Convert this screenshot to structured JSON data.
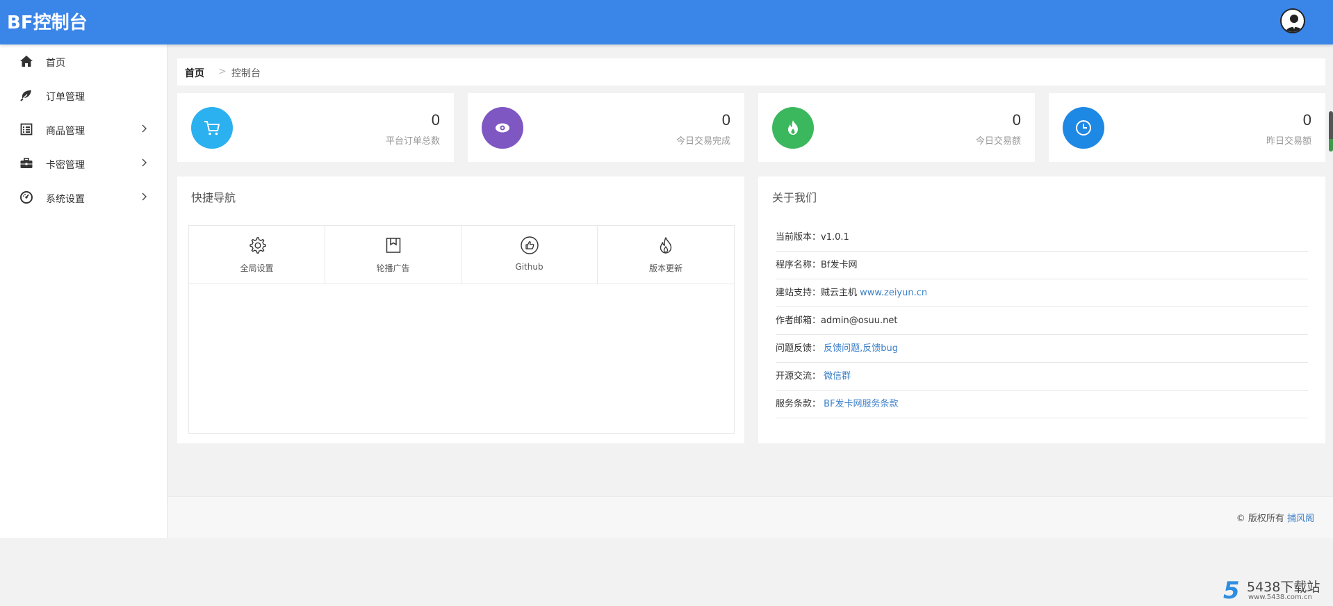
{
  "header": {
    "brand": "BF控制台",
    "avatar_icon": "user-avatar-icon"
  },
  "sidebar": {
    "items": [
      {
        "label": "首页",
        "icon": "home-icon",
        "has_children": false
      },
      {
        "label": "订单管理",
        "icon": "leaf-icon",
        "has_children": false
      },
      {
        "label": "商品管理",
        "icon": "list-icon",
        "has_children": true
      },
      {
        "label": "卡密管理",
        "icon": "briefcase-icon",
        "has_children": true
      },
      {
        "label": "系统设置",
        "icon": "dashboard-icon",
        "has_children": true
      }
    ]
  },
  "breadcrumb": {
    "home": "首页",
    "separator": ">",
    "current": "控制台"
  },
  "stats": [
    {
      "value": "0",
      "label": "平台订单总数",
      "icon": "cart-icon",
      "color": "#2bb0f0"
    },
    {
      "value": "0",
      "label": "今日交易完成",
      "icon": "eye-icon",
      "color": "#7e57c2"
    },
    {
      "value": "0",
      "label": "今日交易额",
      "icon": "fire-icon",
      "color": "#3bb85d"
    },
    {
      "value": "0",
      "label": "昨日交易额",
      "icon": "clock-icon",
      "color": "#1e88e5"
    }
  ],
  "quick_nav": {
    "title": "快捷导航",
    "items": [
      {
        "label": "全局设置",
        "icon": "gear-icon"
      },
      {
        "label": "轮播广告",
        "icon": "bookmark-icon"
      },
      {
        "label": "Github",
        "icon": "thumbs-up-icon"
      },
      {
        "label": "版本更新",
        "icon": "flame-icon"
      }
    ]
  },
  "about": {
    "title": "关于我们",
    "rows": [
      {
        "key": "当前版本：",
        "value": "v1.0.1",
        "link": ""
      },
      {
        "key": "程序名称：",
        "value": "Bf发卡网",
        "link": ""
      },
      {
        "key": "建站支持：",
        "value": "贼云主机 ",
        "link": "www.zeiyun.cn"
      },
      {
        "key": "作者邮箱：",
        "value": "admin@osuu.net",
        "link": ""
      },
      {
        "key": "问题反馈：",
        "value": " ",
        "link": "反馈问题,反馈bug"
      },
      {
        "key": "开源交流：",
        "value": " ",
        "link": "微信群"
      },
      {
        "key": "服务条款：",
        "value": " ",
        "link": "BF发卡网服务条款"
      }
    ]
  },
  "footer": {
    "copyright": "© 版权所有 ",
    "owner_link": "捕风阁"
  },
  "watermark": {
    "mark": "5",
    "name": "5438下载站",
    "url": "www.5438.com.cn"
  }
}
